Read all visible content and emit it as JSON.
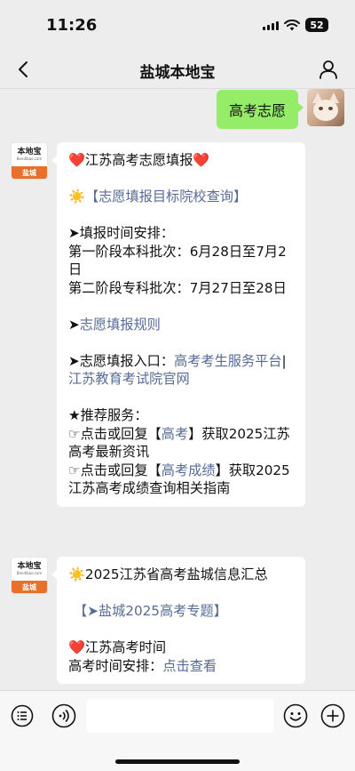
{
  "status": {
    "time": "11:26",
    "battery": "52"
  },
  "nav": {
    "title": "盐城本地宝"
  },
  "outgoing": {
    "text": "高考志愿"
  },
  "bot": {
    "logo_text": "本地宝",
    "logo_site": "Bendibao.com",
    "logo_city": "盐城"
  },
  "message1": {
    "heart_l": "❤️",
    "title": "江苏高考志愿填报",
    "heart_r": "❤️",
    "sun": "☀️",
    "link_query": "【志愿填报目标院校查询】",
    "schedule_header": "➤填报时间安排：",
    "schedule_1": "第一阶段本科批次：6月28日至7月2日",
    "schedule_2": "第二阶段专科批次：7月27日至28日",
    "arrow": "➤",
    "link_rules": "志愿填报规则",
    "entry_label": "➤志愿填报入口：",
    "link_service": "高考考生服务平台",
    "separator": "|",
    "link_official": "江苏教育考试院官网",
    "recommend_header": "★推荐服务：",
    "rec1_prefix": "☞点击或回复【",
    "rec1_link": "高考",
    "rec1_suffix": "】获取2025江苏高考最新资讯",
    "rec2_prefix": "☞点击或回复【",
    "rec2_link": "高考成绩",
    "rec2_suffix": "】获取2025江苏高考成绩查询相关指南"
  },
  "message2": {
    "sun": "☀️",
    "title": "2025江苏省高考盐城信息汇总",
    "link_topic": "【➤盐城2025高考专题】",
    "heart": "❤️",
    "time_header": "江苏高考时间",
    "arrange_label": "高考时间安排：",
    "link_view": "点击查看"
  },
  "input": {
    "placeholder": ""
  }
}
